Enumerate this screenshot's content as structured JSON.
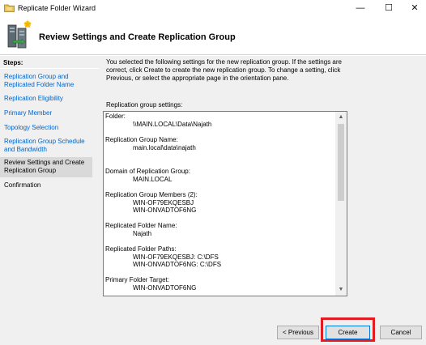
{
  "window": {
    "title": "Replicate Folder Wizard",
    "controls": {
      "minimize": "—",
      "maximize": "☐",
      "close": "✕"
    }
  },
  "header": {
    "title": "Review Settings and Create Replication Group"
  },
  "steps": {
    "title": "Steps:",
    "items": [
      {
        "label": "Replication Group and Replicated Folder Name",
        "state": "link"
      },
      {
        "label": "Replication Eligibility",
        "state": "link"
      },
      {
        "label": "Primary Member",
        "state": "link"
      },
      {
        "label": "Topology Selection",
        "state": "link"
      },
      {
        "label": "Replication Group Schedule and Bandwidth",
        "state": "link"
      },
      {
        "label": "Review Settings and Create Replication Group",
        "state": "current"
      },
      {
        "label": "Confirmation",
        "state": "disabled"
      }
    ]
  },
  "main": {
    "intro": "You selected the following settings for the new replication group. If the settings are correct, click Create to create the new replication group. To change a setting, click Previous, or select the appropriate page in the orientation pane.",
    "settings_label": "Replication group settings:",
    "settings": {
      "folder_label": "Folder:",
      "folder_value": "\\\\MAIN.LOCAL\\Data\\Najath",
      "group_name_label": "Replication Group Name:",
      "group_name_value": "main.local\\data\\najath",
      "domain_label": "Domain of Replication Group:",
      "domain_value": "MAIN.LOCAL",
      "members_label": "Replication Group Members (2):",
      "member_1": "WIN-OF79EKQESBJ",
      "member_2": "WIN-ONVADTOF6NG",
      "folder_name_label": "Replicated Folder Name:",
      "folder_name_value": "Najath",
      "paths_label": "Replicated Folder Paths:",
      "path_1": "WIN-OF79EKQESBJ: C:\\DFS",
      "path_2": "WIN-ONVADTOF6NG: C:\\DFS",
      "primary_label": "Primary Folder Target:",
      "primary_value": "WIN-ONVADTOF6NG"
    },
    "scroll": {
      "up": "▲",
      "down": "▼"
    }
  },
  "buttons": {
    "previous": "< Previous",
    "create": "Create",
    "cancel": "Cancel"
  },
  "colors": {
    "link": "#0066cc",
    "highlight": "#e31b23",
    "default_button_border": "#0078d7"
  }
}
